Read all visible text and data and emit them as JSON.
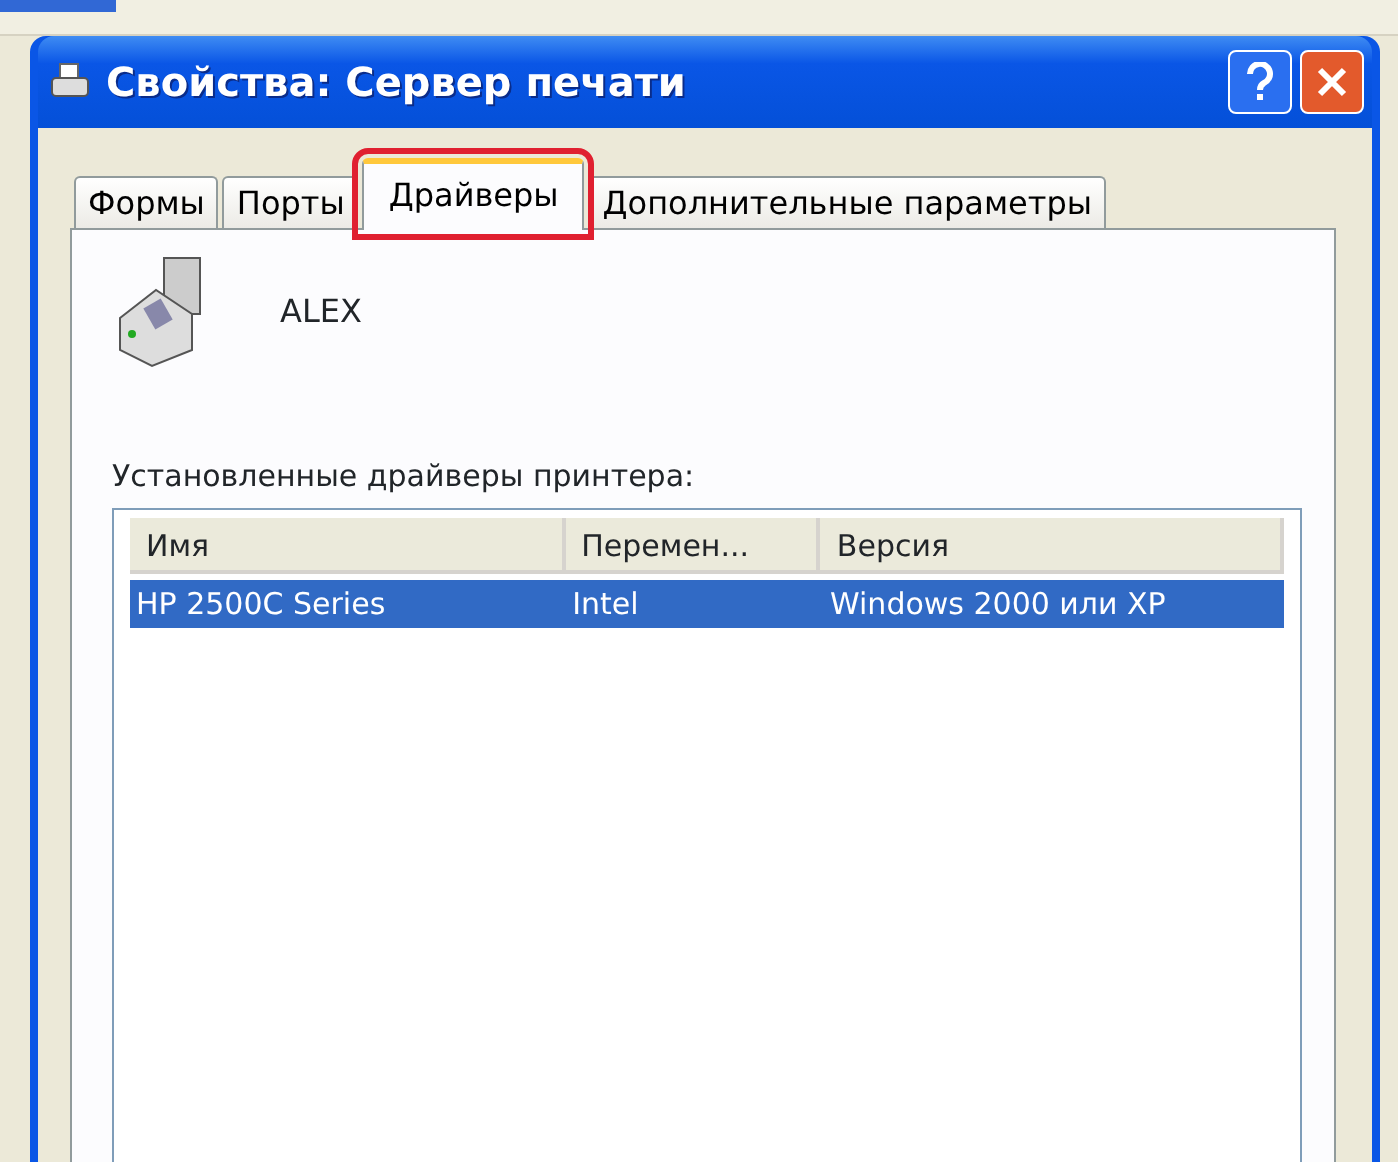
{
  "window": {
    "title": "Свойства: Сервер печати"
  },
  "tabs": [
    {
      "label": "Формы",
      "selected": false,
      "highlighted": false
    },
    {
      "label": "Порты",
      "selected": false,
      "highlighted": false
    },
    {
      "label": "Драйверы",
      "selected": true,
      "highlighted": true
    },
    {
      "label": "Дополнительные параметры",
      "selected": false,
      "highlighted": false
    }
  ],
  "server_name": "ALEX",
  "drivers_label": "Установленные драйверы принтера:",
  "table": {
    "columns": [
      "Имя",
      "Перемен...",
      "Версия"
    ],
    "rows": [
      {
        "cells": [
          "HP 2500C Series",
          "Intel",
          "Windows 2000 или XP"
        ],
        "selected": true
      }
    ]
  }
}
